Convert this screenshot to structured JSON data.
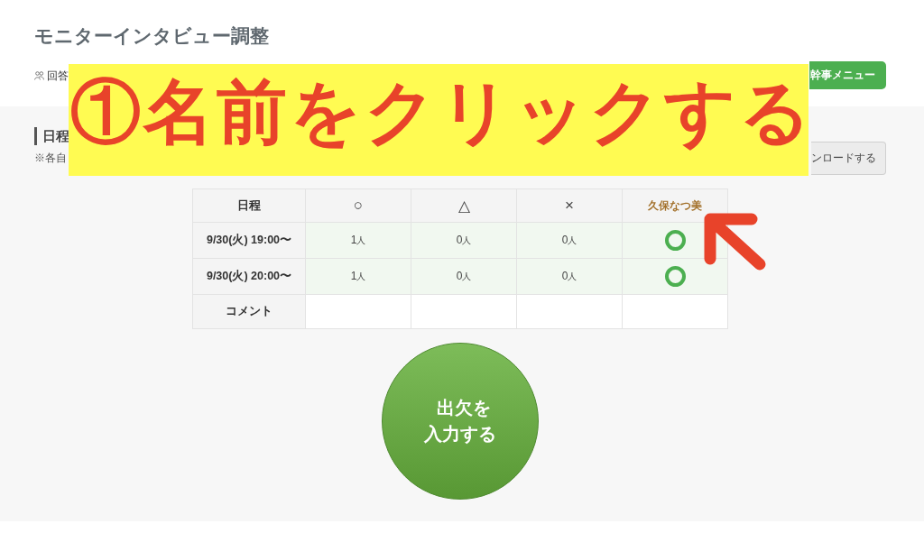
{
  "header": {
    "title": "モニターインタビュー調整",
    "info": {
      "label": "回答"
    },
    "menu_button": {
      "label": "幹事メニュー"
    }
  },
  "schedule": {
    "heading": "日程",
    "note": "※各自",
    "download_button": {
      "label": "ンロードする"
    }
  },
  "table": {
    "columns": [
      {
        "label": "日程",
        "kind": "header"
      },
      {
        "label": "○",
        "kind": "tally"
      },
      {
        "label": "△",
        "kind": "tally"
      },
      {
        "label": "×",
        "kind": "tally"
      },
      {
        "label": "久保なつ美",
        "kind": "member"
      }
    ],
    "rows": [
      {
        "date": "9/30(火) 19:00〜",
        "highlighted": true,
        "counts": [
          {
            "count": "1",
            "unit": "人"
          },
          {
            "count": "0",
            "unit": "人"
          },
          {
            "count": "0",
            "unit": "人"
          }
        ],
        "answers": [
          {
            "available": true
          }
        ]
      },
      {
        "date": "9/30(火) 20:00〜",
        "highlighted": true,
        "counts": [
          {
            "count": "1",
            "unit": "人"
          },
          {
            "count": "0",
            "unit": "人"
          },
          {
            "count": "0",
            "unit": "人"
          }
        ],
        "answers": [
          {
            "available": true
          }
        ]
      }
    ],
    "comment_row": {
      "label": "コメント"
    }
  },
  "entry_button": {
    "label": "出欠を入力する"
  },
  "annotation": {
    "text": "①名前をクリックする"
  }
}
